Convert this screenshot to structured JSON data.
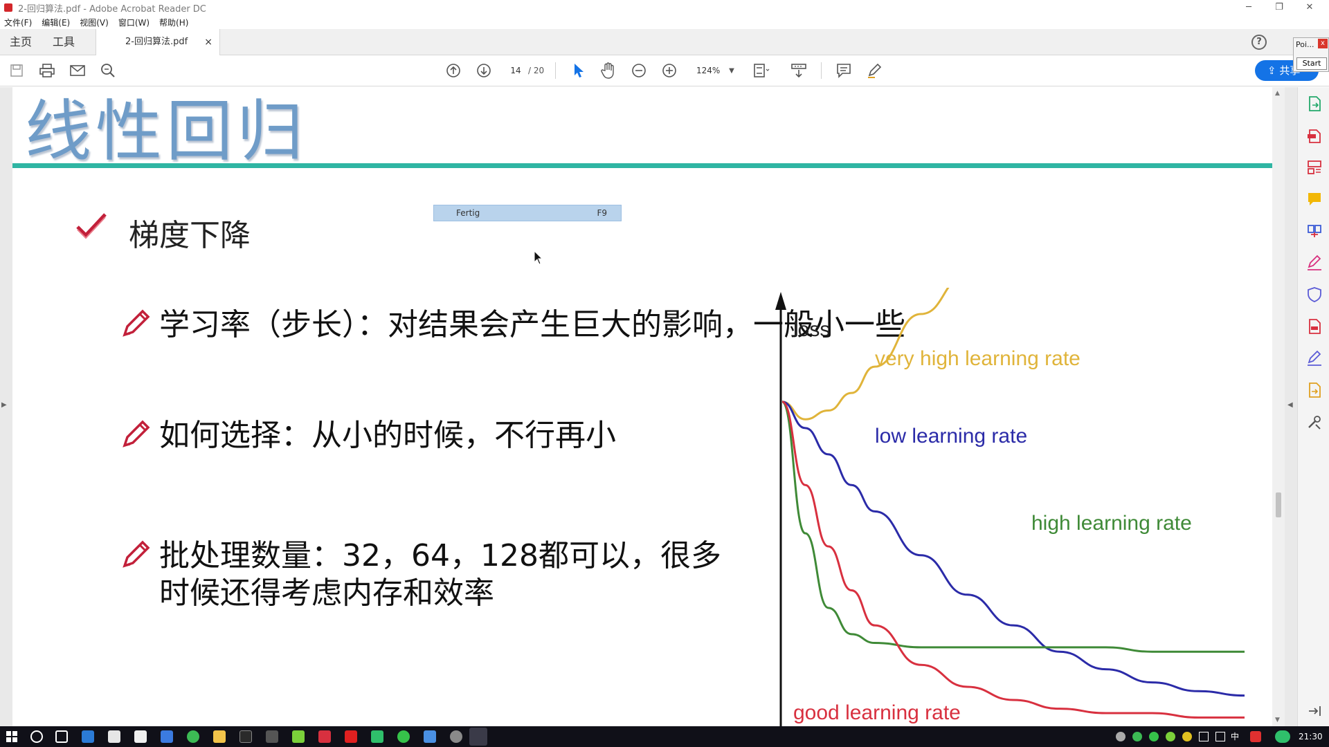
{
  "window": {
    "title": "2-回归算法.pdf - Adobe Acrobat Reader DC",
    "controls": [
      "─",
      "❐",
      "✕"
    ]
  },
  "menu": [
    "文件(F)",
    "编辑(E)",
    "视图(V)",
    "窗口(W)",
    "帮助(H)"
  ],
  "tabs": {
    "home": "主页",
    "tools": "工具",
    "document": "2-回归算法.pdf",
    "close": "×",
    "help": "?"
  },
  "toolbar": {
    "page_current": "14",
    "page_total": "/ 20",
    "zoom": "124%",
    "share_label": "共享"
  },
  "mini_window": {
    "title": "Poi...",
    "close": "x",
    "button": "Start"
  },
  "slide": {
    "heading": "线性回归",
    "subtitle": "梯度下降",
    "bullets": [
      "学习率（步长）：对结果会产生巨大的影响，一般小一些",
      "如何选择：从小的时候，不行再小",
      "批处理数量：32，64，128都可以，很多",
      "时候还得考虑内存和效率"
    ]
  },
  "popup": {
    "label": "Fertig",
    "shortcut": "F9"
  },
  "chart_data": {
    "type": "line",
    "ylabel": "loss",
    "xlabel": "",
    "axis_ticks": false,
    "x": [
      0,
      0.05,
      0.1,
      0.15,
      0.2,
      0.3,
      0.4,
      0.5,
      0.6,
      0.7,
      0.8,
      0.9,
      1.0
    ],
    "series": [
      {
        "name": "very high learning rate",
        "color": "#e0b43a",
        "values": [
          0.74,
          0.7,
          0.72,
          0.76,
          0.82,
          0.94,
          1.03,
          null,
          null,
          null,
          null,
          null,
          null
        ]
      },
      {
        "name": "low learning rate",
        "color": "#2b2ba8",
        "values": [
          0.74,
          0.68,
          0.62,
          0.55,
          0.49,
          0.39,
          0.3,
          0.23,
          0.17,
          0.13,
          0.1,
          0.08,
          0.07
        ]
      },
      {
        "name": "high learning rate",
        "color": "#3f8a37",
        "values": [
          0.74,
          0.44,
          0.27,
          0.21,
          0.19,
          0.18,
          0.18,
          0.18,
          0.18,
          0.18,
          0.17,
          0.17,
          0.17
        ]
      },
      {
        "name": "good learning rate",
        "color": "#d8303f",
        "values": [
          0.74,
          0.55,
          0.41,
          0.31,
          0.23,
          0.14,
          0.09,
          0.06,
          0.04,
          0.03,
          0.03,
          0.02,
          0.02
        ]
      }
    ]
  },
  "taskbar": {
    "ime": "中",
    "clock": "21:30"
  }
}
